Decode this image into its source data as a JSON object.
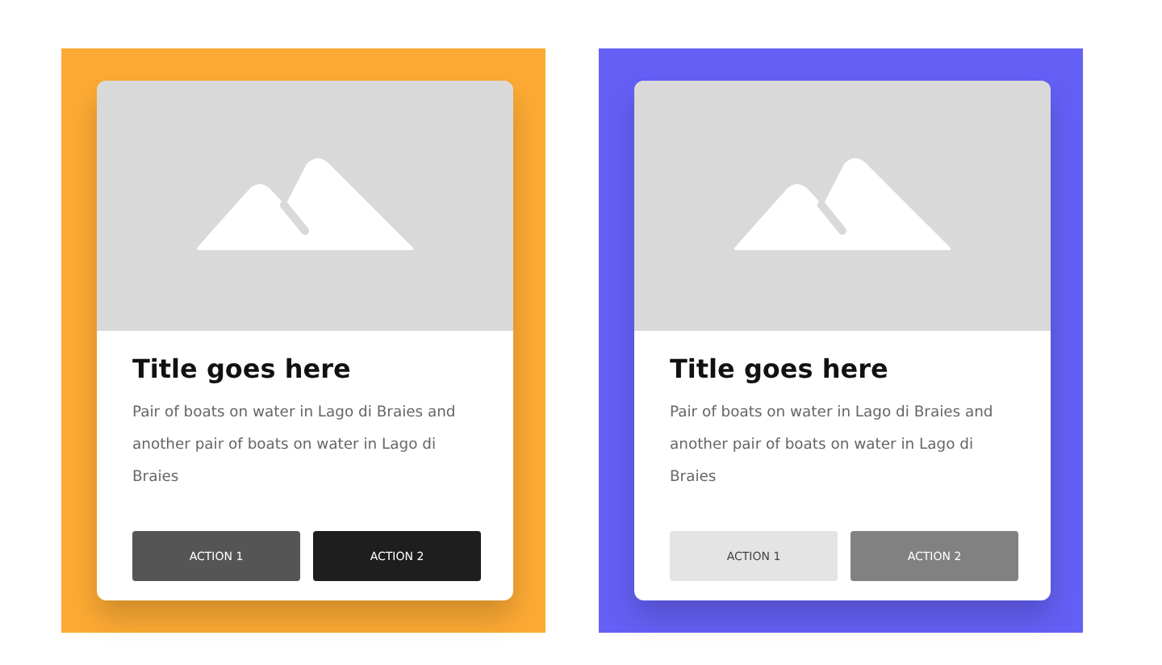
{
  "panels": [
    {
      "color": "#fcaa33",
      "card": {
        "title": "Title goes here",
        "description": "Pair of boats on water in Lago di Braies and another pair of boats on water in Lago di Braies",
        "soft": false,
        "buttons": [
          {
            "label": "ACTION 1",
            "kind": "muted"
          },
          {
            "label": "ACTION 2",
            "kind": "strong"
          }
        ]
      }
    },
    {
      "color": "#6460f6",
      "card": {
        "title": "Title goes here",
        "description": "Pair of boats on water in Lago di Braies and another pair of boats on water in Lago di Braies",
        "soft": true,
        "buttons": [
          {
            "label": "ACTION 1",
            "kind": "muted"
          },
          {
            "label": "ACTION 2",
            "kind": "strong"
          }
        ]
      }
    }
  ]
}
